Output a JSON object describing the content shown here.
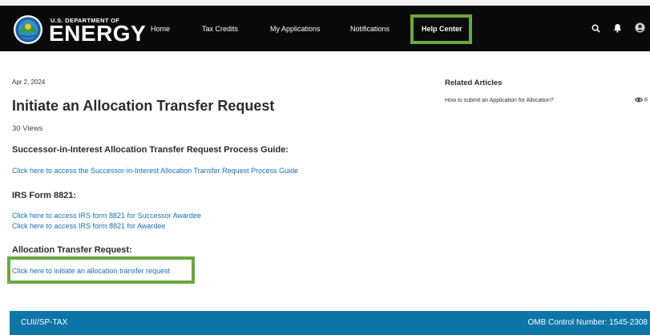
{
  "header": {
    "logo_small": "U.S. DEPARTMENT OF",
    "logo_big": "ENERGY",
    "nav": [
      {
        "label": "Home"
      },
      {
        "label": "Tax Credits"
      },
      {
        "label": "My Applications"
      },
      {
        "label": "Notifications"
      },
      {
        "label": "Help Center"
      }
    ],
    "icons": [
      "search-icon",
      "bell-icon",
      "user-avatar-icon"
    ]
  },
  "article": {
    "date": "Apr 2, 2024",
    "title": "Initiate an Allocation Transfer Request",
    "views": "30 Views",
    "sections": [
      {
        "heading": "Successor-in-Interest Allocation Transfer Request Process Guide:",
        "links": [
          "Click here to access the Successor-in-Interest Allocation Transfer Request Process Guide"
        ]
      },
      {
        "heading": "IRS Form 8821:",
        "links": [
          "Click here to access IRS form 8821 for Successor Awardee",
          "Click here to access IRS form 8821 for Awardee"
        ]
      },
      {
        "heading": "Allocation Transfer Request:",
        "links": [
          "Click here to initiate an allocation transfer request"
        ]
      }
    ]
  },
  "related": {
    "title": "Related Articles",
    "items": [
      {
        "label": "How to submit an Application for Allocation?",
        "views": "8"
      }
    ]
  },
  "footer": {
    "left": "CUI//SP-TAX",
    "right": "OMB Control Number: 1545-2308"
  },
  "colors": {
    "navbar": "#0a0a0a",
    "highlight": "#6aa83e",
    "link": "#1a6fb3",
    "footer": "#0e75a8"
  }
}
